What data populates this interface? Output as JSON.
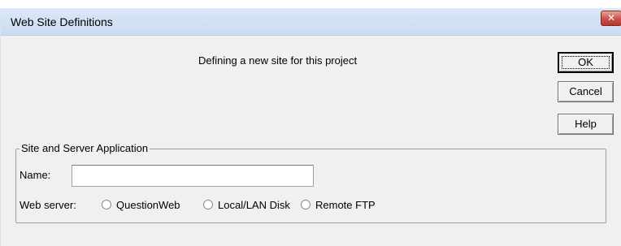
{
  "window": {
    "title": "Web Site Definitions",
    "close_glyph": "✕"
  },
  "subtitle": "Defining a new site for this project",
  "buttons": {
    "ok": "OK",
    "cancel": "Cancel",
    "help": "Help"
  },
  "group": {
    "title": "Site and Server Application",
    "name_label": "Name:",
    "name_value": "",
    "web_server_label": "Web server:",
    "options": [
      "QuestionWeb",
      "Local/LAN Disk",
      "Remote FTP"
    ],
    "selected_option": null
  }
}
